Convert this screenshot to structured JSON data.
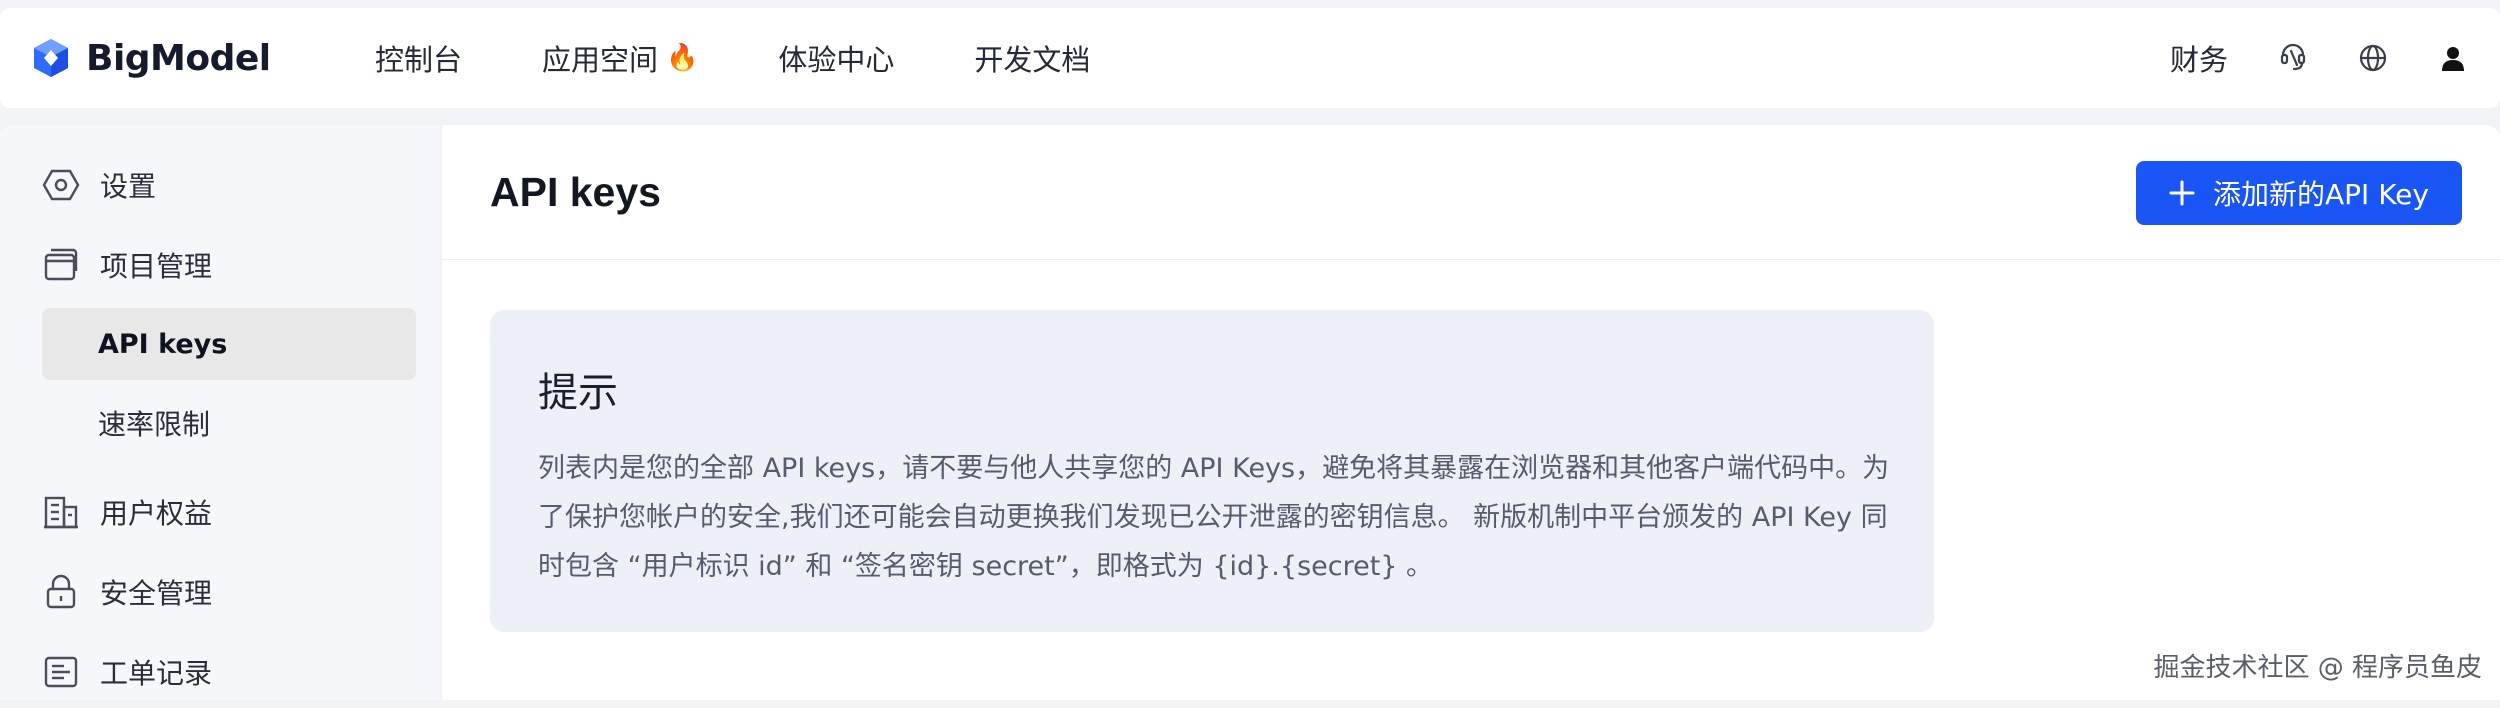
{
  "brand": {
    "name": "BigModel"
  },
  "nav": {
    "items": [
      {
        "label": "控制台"
      },
      {
        "label": "应用空间",
        "badge": "🔥"
      },
      {
        "label": "体验中心"
      },
      {
        "label": "开发文档"
      }
    ],
    "finance_label": "财务",
    "icons": [
      "support-icon",
      "globe-icon",
      "user-icon"
    ]
  },
  "sidebar": {
    "items": [
      {
        "label": "设置",
        "icon": "hexagon-settings-icon"
      },
      {
        "label": "项目管理",
        "icon": "window-stack-icon"
      },
      {
        "label": "API keys",
        "active": true
      },
      {
        "label": "速率限制"
      },
      {
        "label": "用户权益",
        "icon": "building-icon"
      },
      {
        "label": "安全管理",
        "icon": "lock-icon"
      },
      {
        "label": "工单记录",
        "icon": "ticket-list-icon"
      }
    ]
  },
  "main": {
    "title": "API keys",
    "add_button_label": "添加新的API Key",
    "tip": {
      "title": "提示",
      "body": "列表内是您的全部 API keys，请不要与他人共享您的 API Keys，避免将其暴露在浏览器和其他客户端代码中。为了保护您帐户的安全,我们还可能会自动更换我们发现已公开泄露的密钥信息。 新版机制中平台颁发的 API Key 同时包含 “用户标识 id” 和 “签名密钥 secret”，即格式为 {id}.{secret} 。"
    }
  },
  "watermark": "掘金技术社区 @ 程序员鱼皮",
  "colors": {
    "accent": "#1a56f5",
    "tip_background": "#eef0f8",
    "active_item_background": "#e8e8e9"
  }
}
